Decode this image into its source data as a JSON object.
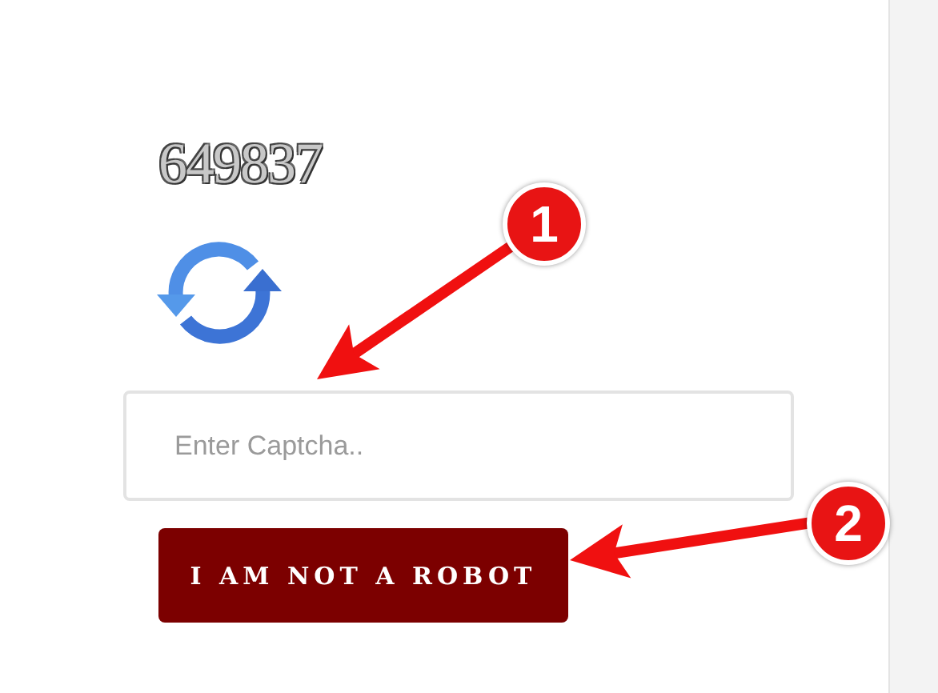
{
  "captcha": {
    "code": "649837",
    "placeholder": "Enter Captcha.."
  },
  "button": {
    "label": "I AM NOT A ROBOT"
  },
  "annotations": [
    {
      "label": "1"
    },
    {
      "label": "2"
    }
  ]
}
